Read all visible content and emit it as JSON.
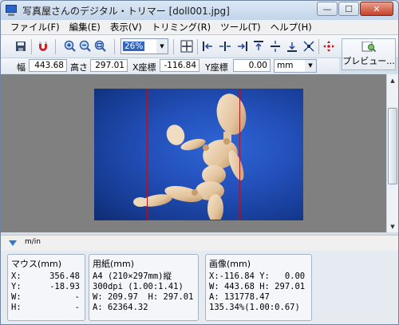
{
  "window": {
    "title": "写真屋さんのデジタル・トリマー [doll001.jpg]",
    "buttons": {
      "minimize": "—",
      "maximize": "☐",
      "close": "✕"
    }
  },
  "menu": [
    "ファイル(F)",
    "編集(E)",
    "表示(V)",
    "トリミング(R)",
    "ツール(T)",
    "ヘルプ(H)"
  ],
  "toolbar": {
    "zoom_value": "26%",
    "preview_label": "プレビュー...",
    "icons": [
      "save-icon",
      "magnet-icon",
      "zoom-in-icon",
      "zoom-out-icon",
      "zoom-fit-icon",
      "center-icon",
      "align-left-icon",
      "align-hcenter-icon",
      "align-right-icon",
      "align-top-icon",
      "align-vcenter-icon",
      "align-bottom-icon",
      "expand-icon",
      "move-icon"
    ]
  },
  "dimensions": {
    "width_label": "幅",
    "width_value": "443.68",
    "height_label": "高さ",
    "height_value": "297.01",
    "x_label": "X座標",
    "x_value": "-116.84",
    "y_label": "Y座標",
    "y_value": "0.00",
    "unit": "mm"
  },
  "info": {
    "toggle_unit": "m/in",
    "mouse": {
      "title": "マウス(mm)",
      "rows": [
        {
          "k": "X:",
          "v": "356.48"
        },
        {
          "k": "Y:",
          "v": "-18.93"
        },
        {
          "k": "W:",
          "v": "-"
        },
        {
          "k": "H:",
          "v": "-"
        }
      ]
    },
    "paper": {
      "title": "用紙(mm)",
      "lines": [
        "A4 (210×297mm)縦",
        "300dpi (1.00:1.41)",
        "W: 209.97  H: 297.01",
        "A: 62364.32"
      ]
    },
    "image": {
      "title": "画像(mm)",
      "lines": [
        "X:-116.84 Y:   0.00",
        "W: 443.68 H: 297.01",
        "A: 131778.47",
        "135.34%(1.00:0.67)"
      ]
    }
  },
  "colors": {
    "photo_background": "#2350ba",
    "crop_frame": "#b3121b",
    "canvas": "#808080"
  }
}
